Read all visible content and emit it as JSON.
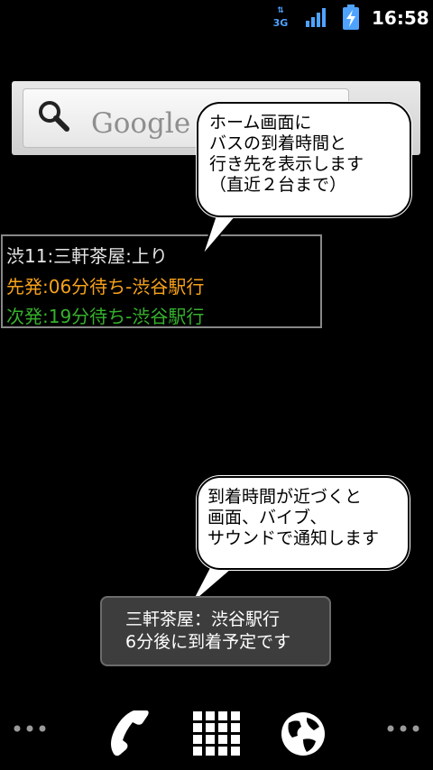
{
  "status_bar": {
    "network": "3G",
    "time": "16:58"
  },
  "search_widget": {
    "logo_text": "Google"
  },
  "callout_top": {
    "lines": [
      "ホーム画面に",
      "バスの到着時間と",
      "行き先を表示します",
      "（直近２台まで）"
    ]
  },
  "bus_widget": {
    "route_stop": "渋11:三軒茶屋:上り",
    "first_departure": "先発:06分待ち-渋谷駅行",
    "next_departure": "次発:19分待ち-渋谷駅行"
  },
  "callout_bottom": {
    "lines": [
      "到着時間が近づくと",
      "画面、バイブ、",
      "サウンドで通知します"
    ]
  },
  "toast": {
    "line1": "三軒茶屋：渋谷駅行",
    "line2": "6分後に到着予定です"
  },
  "colors": {
    "first_departure": "#f7a21a",
    "next_departure": "#36b12c",
    "status_icon": "#4fa3ff"
  },
  "dock": {
    "icons": [
      "more-dots-icon",
      "phone-icon",
      "apps-grid-icon",
      "browser-globe-icon",
      "more-dots-icon"
    ]
  }
}
